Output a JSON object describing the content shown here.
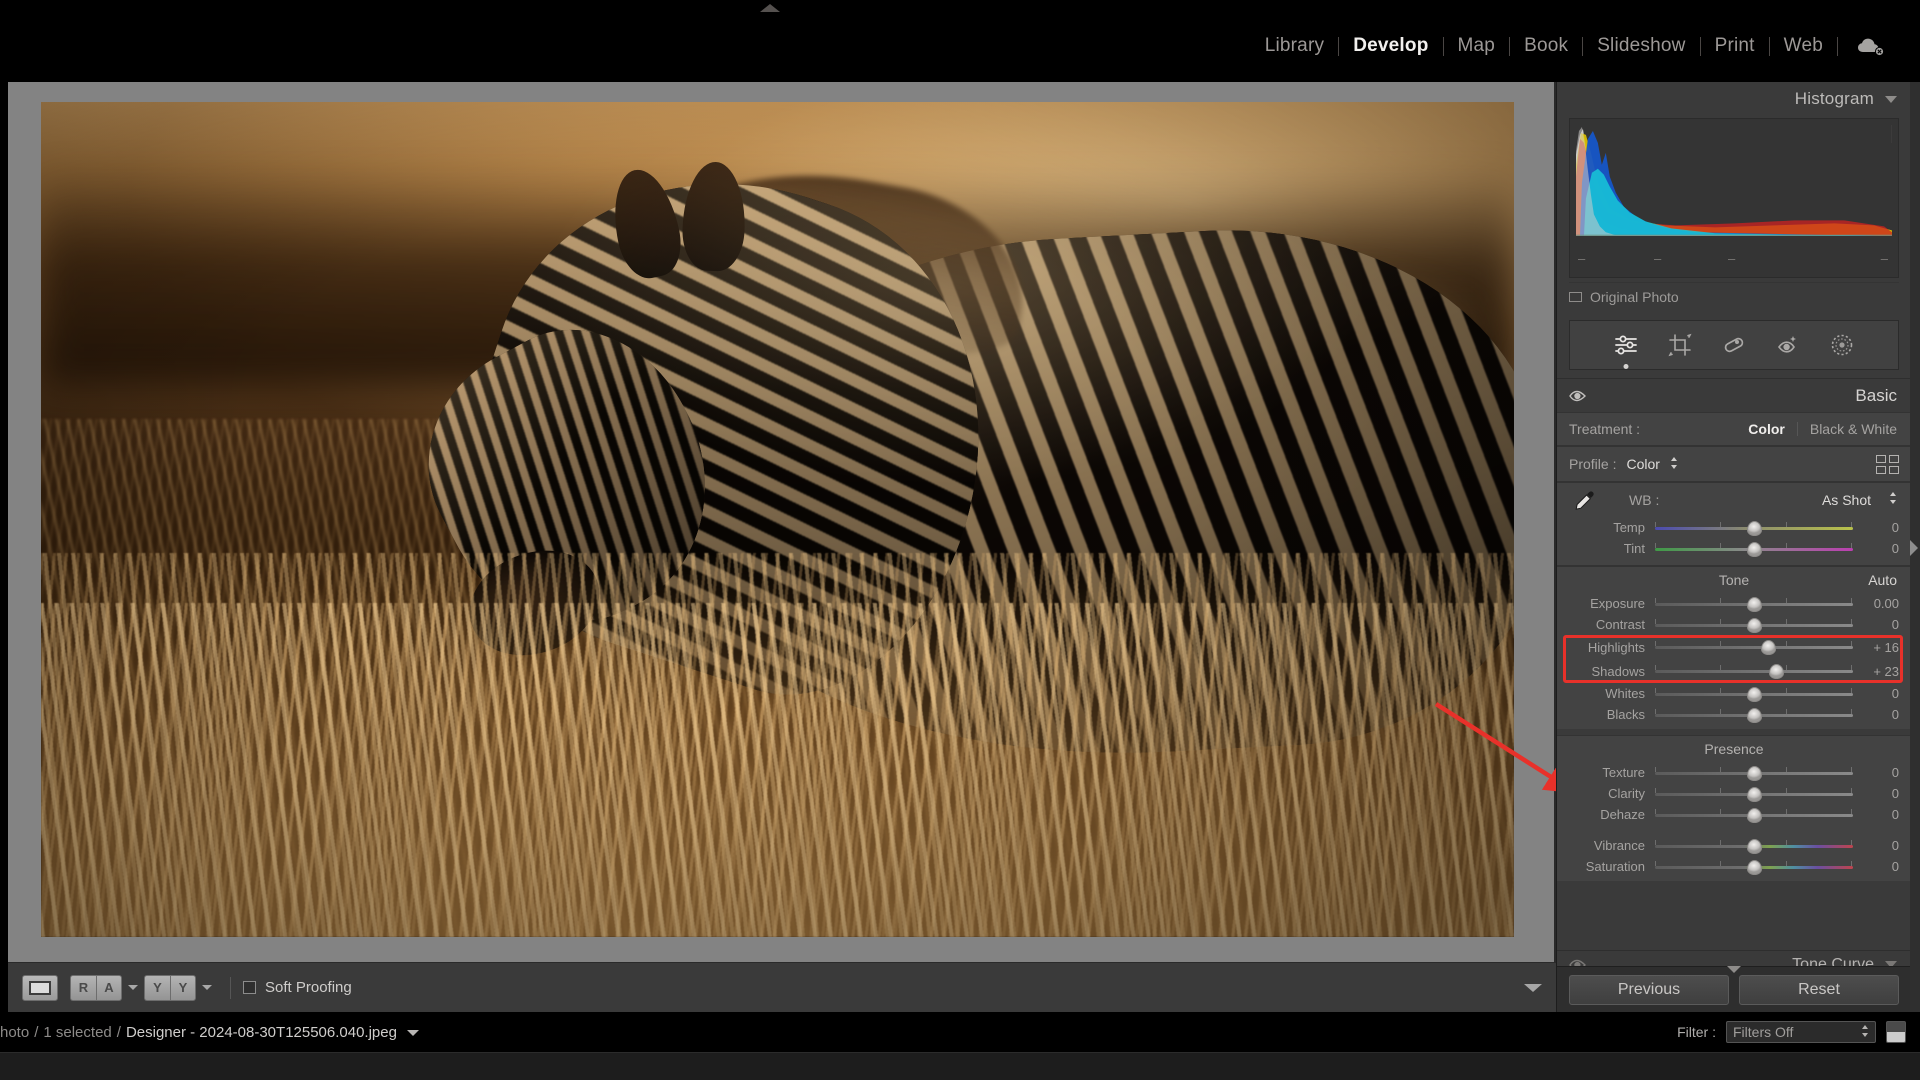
{
  "app": {
    "module_bar": [
      {
        "label": "Library",
        "active": false
      },
      {
        "label": "Develop",
        "active": true
      },
      {
        "label": "Map",
        "active": false
      },
      {
        "label": "Book",
        "active": false
      },
      {
        "label": "Slideshow",
        "active": false
      },
      {
        "label": "Print",
        "active": false
      },
      {
        "label": "Web",
        "active": false
      }
    ],
    "cloud_icon": "cloud-sync-off-icon",
    "top_panel_handle": "collapse-top-panel-triangle"
  },
  "histogram": {
    "title": "Histogram",
    "disclosure": "chevron-down-icon",
    "shadow_clipping": "shadow-clipping-toggle",
    "highlight_clipping": "highlight-clipping-toggle",
    "tick_labels": [
      "–",
      "–",
      "–",
      "–"
    ],
    "original_photo_label": "Original Photo",
    "channels": [
      "red",
      "green",
      "blue",
      "luminance"
    ]
  },
  "toolstrip": {
    "tools": [
      {
        "name": "edit-sliders-icon",
        "label": "Edit",
        "selected": true
      },
      {
        "name": "crop-overlay-icon",
        "label": "Crop",
        "selected": false
      },
      {
        "name": "healing-brush-icon",
        "label": "Healing",
        "selected": false
      },
      {
        "name": "red-eye-icon",
        "label": "Red Eye",
        "selected": false
      },
      {
        "name": "masking-icon",
        "label": "Masking",
        "selected": false
      }
    ]
  },
  "basic": {
    "title": "Basic",
    "visibility_icon": "eye-icon",
    "disclosure": "chevron-down-icon",
    "treatment": {
      "label": "Treatment :",
      "options": [
        {
          "label": "Color",
          "active": true
        },
        {
          "label": "Black & White",
          "active": false
        }
      ]
    },
    "profile": {
      "label": "Profile :",
      "value": "Color",
      "stepper": "up-down-stepper-icon",
      "browser_icon": "profile-browser-grid-icon"
    },
    "white_balance": {
      "eyedropper": "white-balance-selector-icon",
      "label": "WB :",
      "value": "As Shot",
      "stepper": "up-down-stepper-icon"
    },
    "wb_sliders": [
      {
        "name": "Temp",
        "value": "0",
        "pos": 50,
        "track": "temp"
      },
      {
        "name": "Tint",
        "value": "0",
        "pos": 50,
        "track": "tint"
      }
    ],
    "tone": {
      "title": "Tone",
      "auto_label": "Auto",
      "sliders": [
        {
          "name": "Exposure",
          "value": "0.00",
          "pos": 50,
          "track": "plain",
          "highlighted": false
        },
        {
          "name": "Contrast",
          "value": "0",
          "pos": 50,
          "track": "plain",
          "highlighted": false
        },
        {
          "name": "Highlights",
          "value": "+ 16",
          "pos": 57,
          "track": "plain",
          "highlighted": true
        },
        {
          "name": "Shadows",
          "value": "+ 23",
          "pos": 61,
          "track": "plain",
          "highlighted": true
        },
        {
          "name": "Whites",
          "value": "0",
          "pos": 50,
          "track": "plain",
          "highlighted": false
        },
        {
          "name": "Blacks",
          "value": "0",
          "pos": 50,
          "track": "plain",
          "highlighted": false
        }
      ]
    },
    "presence": {
      "title": "Presence",
      "sliders": [
        {
          "name": "Texture",
          "value": "0",
          "pos": 50,
          "track": "plain"
        },
        {
          "name": "Clarity",
          "value": "0",
          "pos": 50,
          "track": "plain"
        },
        {
          "name": "Dehaze",
          "value": "0",
          "pos": 50,
          "track": "plain"
        },
        {
          "name": "Vibrance",
          "value": "0",
          "pos": 50,
          "track": "vib"
        },
        {
          "name": "Saturation",
          "value": "0",
          "pos": 50,
          "track": "vib"
        }
      ]
    }
  },
  "tone_curve": {
    "title": "Tone Curve",
    "visibility_icon": "eye-icon",
    "disclosure": "chevron-up-icon"
  },
  "panel_buttons": {
    "previous": "Previous",
    "reset": "Reset"
  },
  "photo_toolbar": {
    "view_loupe": "loupe-view-icon",
    "before_after": "RA",
    "before_after_caret": "chevron-down-icon",
    "compare": "YY",
    "compare_caret": "chevron-down-icon",
    "soft_proofing_checkbox": "soft-proofing-checkbox",
    "soft_proofing_label": "Soft Proofing",
    "toolbar_caret": "show-hide-toolbar-icon"
  },
  "statusbar": {
    "photo_count": "hoto",
    "selected": "1 selected",
    "filename": "Designer - 2024-08-30T125506.040.jpeg",
    "filename_caret": "chevron-down-icon",
    "filter_label": "Filter :",
    "filter_value": "Filters Off",
    "filter_stepper": "up-down-stepper-icon",
    "filter_swatch": "filter-preset-swatch"
  },
  "annotation": {
    "arrow": "red-callout-arrow",
    "highlight_box": "red-highlight-rectangle",
    "color": "#e8312a"
  },
  "colors": {
    "panel_bg": "#3a3a3a",
    "app_bg": "#000000",
    "stage_bg": "#838383",
    "text_primary": "#d6d4d2",
    "text_secondary": "#a5a3a1",
    "accent_red": "#e8312a"
  }
}
